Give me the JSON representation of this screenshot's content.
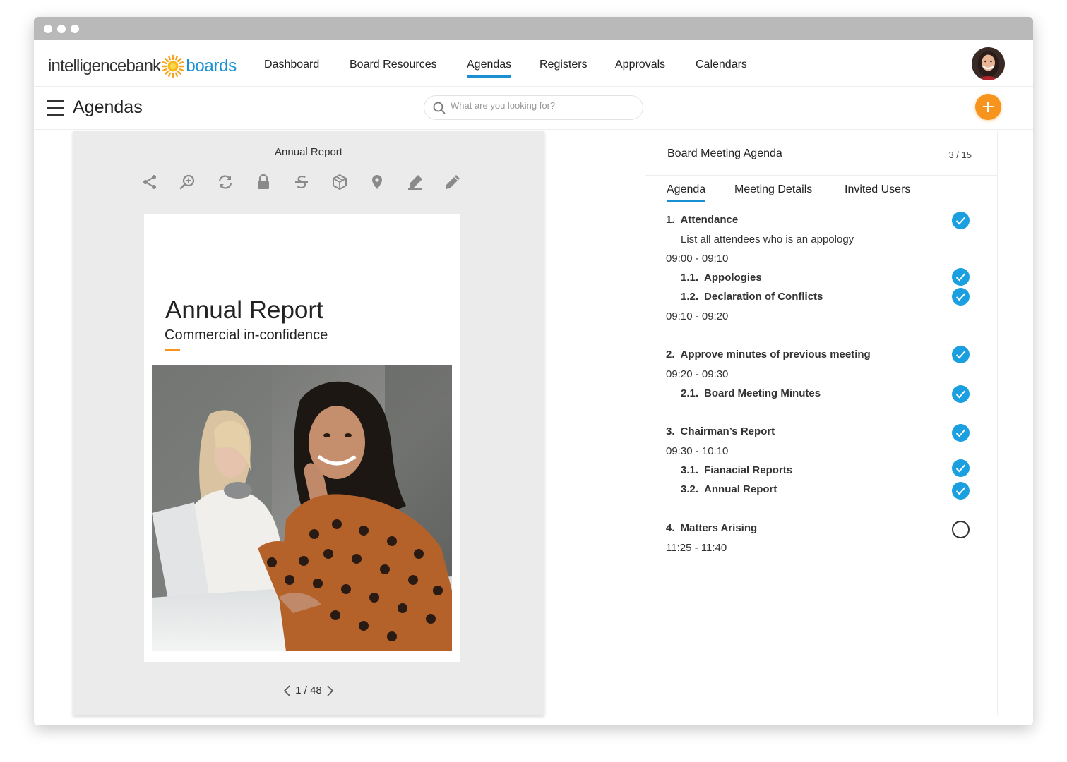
{
  "brand": {
    "logo_text_1": "intelligencebank",
    "logo_text_2": "boards",
    "accent": "#1a8fd3",
    "orange": "#f7941d"
  },
  "nav": {
    "items": [
      "Dashboard",
      "Board Resources",
      "Agendas",
      "Registers",
      "Approvals",
      "Calendars"
    ],
    "active": "Agendas"
  },
  "subbar": {
    "title": "Agendas",
    "search_placeholder": "What are you looking for?"
  },
  "viewer": {
    "title": "Annual Report",
    "tools": [
      "share-icon",
      "zoom-icon",
      "rotate-icon",
      "lock-icon",
      "strikethrough-icon",
      "package-icon",
      "location-pin-icon",
      "highlighter-icon",
      "pencil-icon"
    ],
    "doc_heading": "Annual Report",
    "doc_subheading": "Commercial in-confidence",
    "page_indicator": "1 / 48"
  },
  "agenda": {
    "title": "Board Meeting Agenda",
    "count": "3 / 15",
    "tabs": [
      "Agenda",
      "Meeting Details",
      "Invited Users"
    ],
    "active_tab": "Agenda",
    "items": [
      {
        "num": "1.",
        "title": "Attendance",
        "checked": true
      },
      {
        "text": "List all attendees who is an appology"
      },
      {
        "time": "09:00 - 09:10"
      },
      {
        "num": "1.1.",
        "title": "Appologies",
        "checked": true
      },
      {
        "num": "1.2.",
        "title": "Declaration of Conflicts",
        "checked": true
      },
      {
        "time": "09:10 - 09:20"
      },
      {
        "num": "2.",
        "title": "Approve minutes of previous meeting",
        "checked": true
      },
      {
        "time": "09:20 - 09:30"
      },
      {
        "num": "2.1.",
        "title": "Board Meeting Minutes",
        "checked": true
      },
      {
        "num": "3.",
        "title": "Chairman’s Report",
        "checked": true
      },
      {
        "time": "09:30 - 10:10"
      },
      {
        "num": "3.1.",
        "title": "Fianacial Reports",
        "checked": true
      },
      {
        "num": "3.2.",
        "title": "Annual Report",
        "checked": true
      },
      {
        "num": "4.",
        "title": "Matters Arising",
        "checked": false
      },
      {
        "time": "11:25 - 11:40"
      }
    ]
  }
}
